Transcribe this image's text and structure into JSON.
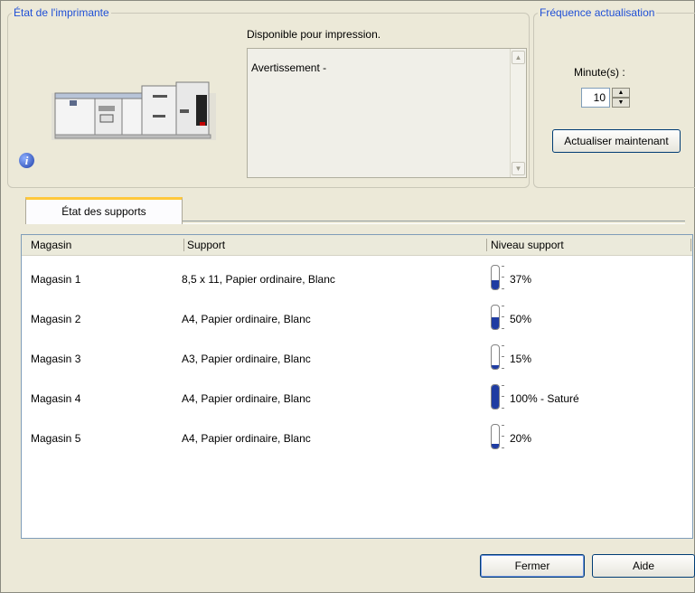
{
  "printer_status": {
    "title": "État de l'imprimante",
    "status_text": "Disponible pour impression.",
    "warning_text": "Avertissement -"
  },
  "refresh": {
    "title": "Fréquence actualisation",
    "minute_label": "Minute(s) :",
    "minute_value": "10",
    "refresh_now_label": "Actualiser maintenant"
  },
  "tabs": [
    {
      "label": "État des supports",
      "selected": true
    }
  ],
  "table": {
    "columns": [
      "Magasin",
      "Support",
      "Niveau support"
    ],
    "rows": [
      {
        "tray": "Magasin 1",
        "media": "8,5 x 11, Papier ordinaire, Blanc",
        "level_text": "37%",
        "level": 0.37
      },
      {
        "tray": "Magasin 2",
        "media": "A4, Papier ordinaire, Blanc",
        "level_text": "50%",
        "level": 0.5
      },
      {
        "tray": "Magasin 3",
        "media": "A3, Papier ordinaire, Blanc",
        "level_text": "15%",
        "level": 0.15
      },
      {
        "tray": "Magasin 4",
        "media": "A4, Papier ordinaire, Blanc",
        "level_text": "100% - Saturé",
        "level": 1.0
      },
      {
        "tray": "Magasin 5",
        "media": "A4, Papier ordinaire, Blanc",
        "level_text": "20%",
        "level": 0.2
      }
    ]
  },
  "buttons": {
    "close_label": "Fermer",
    "help_label": "Aide"
  },
  "icons": {
    "printer": "printer-icon",
    "info": "info-icon",
    "level_gauge": "tray-level-gauge-icon"
  },
  "colors": {
    "group_title": "#1f4fd6",
    "tab_accent": "#ffc83c",
    "gauge_fill": "#1f3ca2"
  }
}
